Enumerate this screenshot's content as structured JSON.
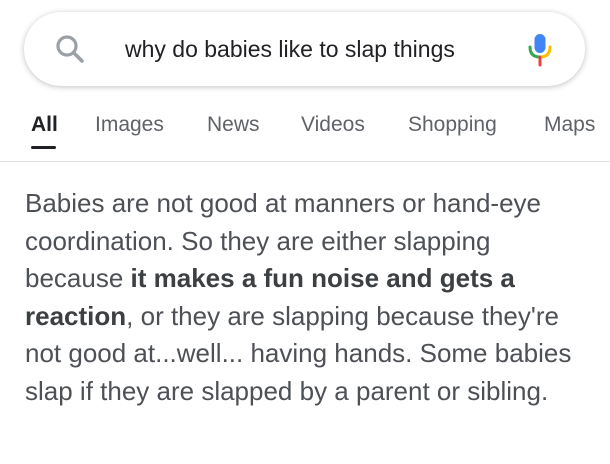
{
  "search": {
    "query": "why do babies like to slap things",
    "search_icon": "magnifier-icon",
    "mic_icon": "microphone-icon"
  },
  "tabs": [
    {
      "label": "All",
      "active": true
    },
    {
      "label": "Images",
      "active": false
    },
    {
      "label": "News",
      "active": false
    },
    {
      "label": "Videos",
      "active": false
    },
    {
      "label": "Shopping",
      "active": false
    },
    {
      "label": "Maps",
      "active": false
    }
  ],
  "snippet": {
    "part1": "Babies are not good at manners or hand-eye coordination. So they are either slapping because ",
    "bold": "it makes a fun noise and gets a reaction",
    "part2": ", or they are slapping because they're not good at...well... having hands. Some babies slap if they are slapped by a parent or sibling."
  },
  "colors": {
    "mic_blue": "#4285F4",
    "mic_red": "#EA4335",
    "mic_yellow": "#FBBC05",
    "mic_green": "#34A853"
  }
}
